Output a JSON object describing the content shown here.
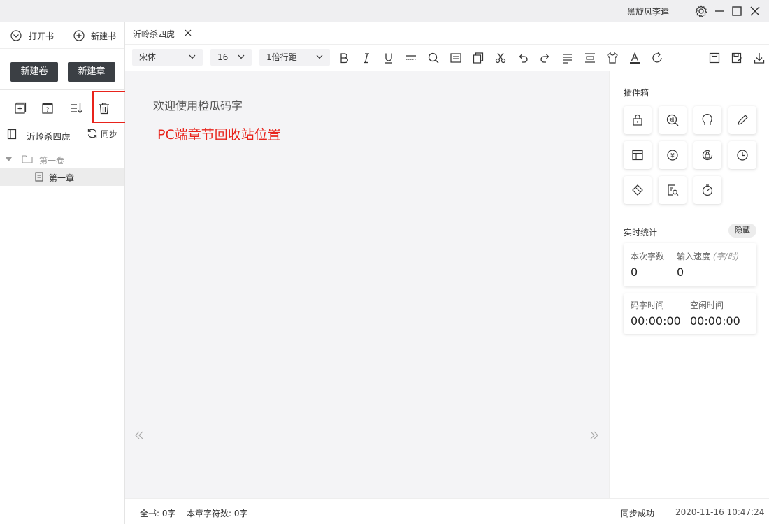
{
  "titlebar": {
    "username": "黑旋风李逵"
  },
  "sidebar": {
    "open_book": "打开书",
    "new_book": "新建书",
    "new_volume": "新建卷",
    "new_chapter": "新建章",
    "book_title": "沂岭杀四虎",
    "sync": "同步",
    "tree": {
      "volume": "第一卷",
      "chapter": "第一章"
    }
  },
  "tabs": [
    {
      "label": "沂岭杀四虎"
    }
  ],
  "toolbar": {
    "font": "宋体",
    "size": "16",
    "line_spacing": "1倍行距"
  },
  "editor": {
    "placeholder": "欢迎使用橙瓜码字",
    "annotation": "PC端章节回收站位置",
    "annotation_color": "#e8231b"
  },
  "rightpanel": {
    "plugins_title": "插件箱",
    "stats_title": "实时统计",
    "hide_label": "隐藏",
    "stats": {
      "session_words_label": "本次字数",
      "session_words": "0",
      "speed_label": "输入速度",
      "speed_unit": "(字/时)",
      "speed": "0",
      "typing_time_label": "码字时间",
      "typing_time": "00:00:00",
      "idle_time_label": "空闲时间",
      "idle_time": "00:00:00"
    }
  },
  "statusbar": {
    "book_words": "全书: 0字",
    "chapter_chars": "本章字符数: 0字",
    "sync_status": "同步成功",
    "timestamp": "2020-11-16 10:47:24"
  }
}
